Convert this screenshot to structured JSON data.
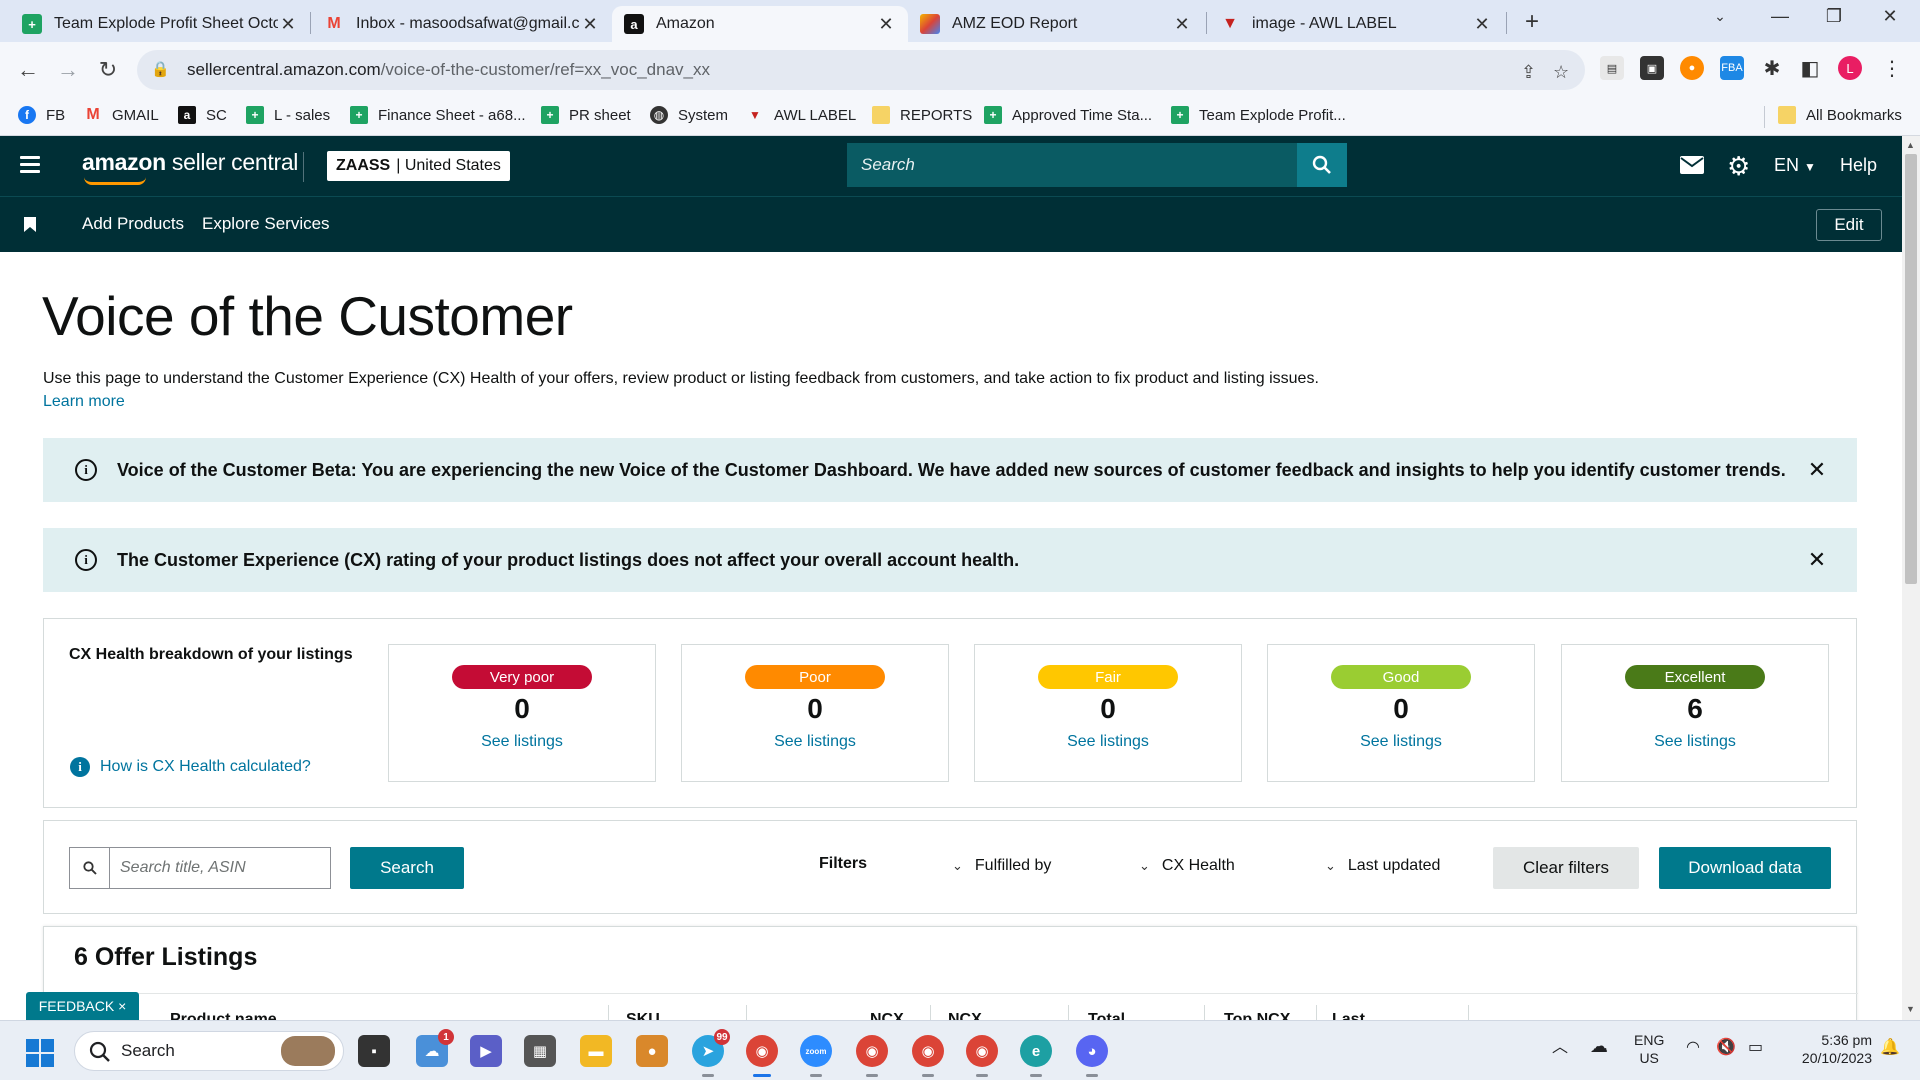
{
  "browser": {
    "tabs": [
      {
        "title": "Team Explode Profit Sheet Octob",
        "favicon": "sheets-icon"
      },
      {
        "title": "Inbox - masoodsafwat@gmail.co",
        "favicon": "gmail-icon"
      },
      {
        "title": "Amazon",
        "favicon": "amazon-icon",
        "active": true
      },
      {
        "title": "AMZ EOD Report",
        "favicon": "report-icon"
      },
      {
        "title": "image - AWL LABEL",
        "favicon": "awl-icon"
      }
    ],
    "url_domain": "sellercentral.amazon.com",
    "url_path": "/voice-of-the-customer/ref=xx_voc_dnav_xx",
    "profile_initial": "L",
    "bookmarks": [
      {
        "label": "FB"
      },
      {
        "label": "GMAIL"
      },
      {
        "label": "SC"
      },
      {
        "label": "L - sales"
      },
      {
        "label": "Finance Sheet - a68..."
      },
      {
        "label": "PR sheet"
      },
      {
        "label": "System"
      },
      {
        "label": "AWL LABEL"
      },
      {
        "label": "REPORTS"
      },
      {
        "label": "Approved Time Sta..."
      },
      {
        "label": "Team Explode Profit..."
      }
    ],
    "all_bookmarks": "All Bookmarks"
  },
  "header": {
    "logo_bold": "amazon",
    "logo_rest": " seller central",
    "account_name": "ZAASS",
    "account_region": "| United States",
    "search_placeholder": "Search",
    "language": "EN",
    "help": "Help",
    "sub_links": [
      "Add Products",
      "Explore Services"
    ],
    "edit": "Edit"
  },
  "page": {
    "title": "Voice of the Customer",
    "intro": "Use this page to understand the Customer Experience (CX) Health of your offers, review product or listing feedback from customers, and take action to fix product and listing issues.",
    "learn_more": "Learn more",
    "banner1": "Voice of the Customer Beta: You are experiencing the new Voice of the Customer Dashboard. We have added new sources of customer feedback and insights to help you identify customer trends.",
    "banner2": "The Customer Experience (CX) rating of your product listings does not affect your overall account health.",
    "cx_title": "CX Health breakdown of your listings",
    "cx_help": "How is CX Health calculated?",
    "cx_cards": [
      {
        "label": "Very poor",
        "count": "0",
        "link": "See listings",
        "color": "#c40c35",
        "text": "#ffffff"
      },
      {
        "label": "Poor",
        "count": "0",
        "link": "See listings",
        "color": "#ff8a00",
        "text": "#ffffff"
      },
      {
        "label": "Fair",
        "count": "0",
        "link": "See listings",
        "color": "#ffc700",
        "text": "#ffffff"
      },
      {
        "label": "Good",
        "count": "0",
        "link": "See listings",
        "color": "#9acd32",
        "text": "#ffffff"
      },
      {
        "label": "Excellent",
        "count": "6",
        "link": "See listings",
        "color": "#4a7a18",
        "text": "#ffffff"
      }
    ],
    "filter_search_placeholder": "Search title, ASIN",
    "search_button": "Search",
    "filters_label": "Filters",
    "filter_dropdowns": [
      "Fulfilled by",
      "CX Health",
      "Last updated"
    ],
    "clear_filters": "Clear filters",
    "download_data": "Download data",
    "offers_title": "6 Offer Listings",
    "table_headers": [
      "Product name",
      "SKU",
      "NCX",
      "NCX",
      "Total",
      "Top NCX",
      "Last"
    ],
    "feedback": "FEEDBACK ×"
  },
  "taskbar": {
    "search": "Search",
    "lang_top": "ENG",
    "lang_bottom": "US",
    "time": "5:36 pm",
    "date": "20/10/2023"
  }
}
